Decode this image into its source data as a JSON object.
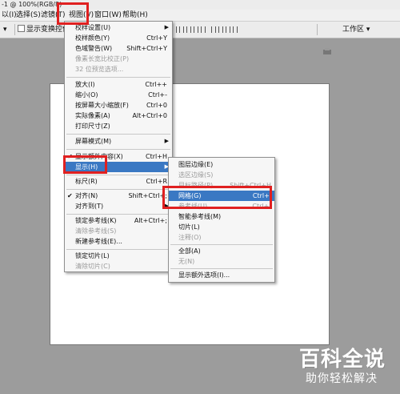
{
  "title_bar": {
    "text": "-1 @ 100%(RGB/8)"
  },
  "menubar": {
    "items": [
      "以(I)",
      "选择(S)",
      "滤镜(T)",
      "视图(V)",
      "窗口(W)",
      "帮助(H)"
    ]
  },
  "toolbar": {
    "dropdown_arrow": "▾",
    "show_transform_controls": "显示变换控件",
    "workspace": "工作区 ▾"
  },
  "view_menu": {
    "items": [
      {
        "label": "校样设置(U)",
        "shortcut": "",
        "disabled": false,
        "checked": false,
        "submenu": true
      },
      {
        "label": "校样颜色(Y)",
        "shortcut": "Ctrl+Y",
        "disabled": false,
        "checked": false,
        "submenu": false
      },
      {
        "label": "色域警告(W)",
        "shortcut": "Shift+Ctrl+Y",
        "disabled": false,
        "checked": false,
        "submenu": false
      },
      {
        "label": "像素长宽比校正(P)",
        "shortcut": "",
        "disabled": true,
        "checked": false,
        "submenu": false
      },
      {
        "label": "32 位预览选项...",
        "shortcut": "",
        "disabled": true,
        "checked": false,
        "submenu": false
      },
      {
        "label": "放大(I)",
        "shortcut": "Ctrl++",
        "disabled": false,
        "checked": false,
        "submenu": false
      },
      {
        "label": "缩小(O)",
        "shortcut": "Ctrl+-",
        "disabled": false,
        "checked": false,
        "submenu": false
      },
      {
        "label": "按屏幕大小缩放(F)",
        "shortcut": "Ctrl+0",
        "disabled": false,
        "checked": false,
        "submenu": false
      },
      {
        "label": "实际像素(A)",
        "shortcut": "Alt+Ctrl+0",
        "disabled": false,
        "checked": false,
        "submenu": false
      },
      {
        "label": "打印尺寸(Z)",
        "shortcut": "",
        "disabled": false,
        "checked": false,
        "submenu": false
      },
      {
        "label": "屏幕模式(M)",
        "shortcut": "",
        "disabled": false,
        "checked": false,
        "submenu": true
      },
      {
        "label": "显示额外内容(X)",
        "shortcut": "Ctrl+H",
        "disabled": false,
        "checked": true,
        "submenu": false
      },
      {
        "label": "显示(H)",
        "shortcut": "",
        "disabled": false,
        "checked": false,
        "submenu": true,
        "highlighted": true
      },
      {
        "label": "标尺(R)",
        "shortcut": "Ctrl+R",
        "disabled": false,
        "checked": false,
        "submenu": false
      },
      {
        "label": "对齐(N)",
        "shortcut": "Shift+Ctrl+;",
        "disabled": false,
        "checked": true,
        "submenu": false
      },
      {
        "label": "对齐到(T)",
        "shortcut": "",
        "disabled": false,
        "checked": false,
        "submenu": true
      },
      {
        "label": "锁定参考线(K)",
        "shortcut": "Alt+Ctrl+;",
        "disabled": false,
        "checked": false,
        "submenu": false
      },
      {
        "label": "清除参考线(S)",
        "shortcut": "",
        "disabled": true,
        "checked": false,
        "submenu": false
      },
      {
        "label": "新建参考线(E)...",
        "shortcut": "",
        "disabled": false,
        "checked": false,
        "submenu": false
      },
      {
        "label": "锁定切片(L)",
        "shortcut": "",
        "disabled": false,
        "checked": false,
        "submenu": false
      },
      {
        "label": "清除切片(C)",
        "shortcut": "",
        "disabled": true,
        "checked": false,
        "submenu": false
      }
    ]
  },
  "show_submenu": {
    "items": [
      {
        "label": "图层边缘(E)",
        "shortcut": "",
        "disabled": false
      },
      {
        "label": "选区边缘(S)",
        "shortcut": "",
        "disabled": true
      },
      {
        "label": "目标路径(P)",
        "shortcut": "Shift+Ctrl+H",
        "disabled": true
      },
      {
        "label": "网格(G)",
        "shortcut": "Ctrl+'",
        "disabled": false,
        "highlighted": true
      },
      {
        "label": "参考线(U)",
        "shortcut": "Ctrl+;",
        "disabled": true
      },
      {
        "label": "智能参考线(M)",
        "shortcut": "",
        "disabled": false
      },
      {
        "label": "切片(L)",
        "shortcut": "",
        "disabled": false
      },
      {
        "label": "注释(O)",
        "shortcut": "",
        "disabled": true
      },
      {
        "label": "全部(A)",
        "shortcut": "",
        "disabled": false
      },
      {
        "label": "无(N)",
        "shortcut": "",
        "disabled": true
      },
      {
        "label": "显示额外选项(I)...",
        "shortcut": "",
        "disabled": false
      }
    ]
  },
  "watermark": {
    "line1": "百科全说",
    "line2": "助你轻松解决"
  },
  "colors": {
    "highlight": "#3a78c3",
    "annotation_red": "#e02020",
    "workspace_bg": "#9c9c9c"
  }
}
